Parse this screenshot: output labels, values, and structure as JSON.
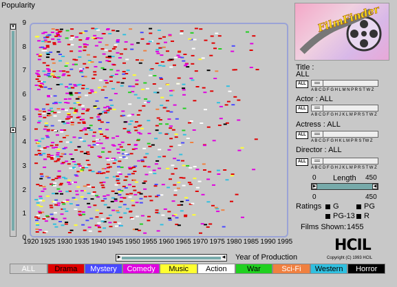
{
  "yaxis": {
    "label": "Popularity",
    "ticks": [
      "0",
      "1",
      "2",
      "3",
      "4",
      "5",
      "6",
      "7",
      "8",
      "9"
    ]
  },
  "xaxis": {
    "label": "Year of Production",
    "ticks": [
      "1920",
      "1925",
      "1930",
      "1935",
      "1940",
      "1945",
      "1950",
      "1955",
      "1960",
      "1965",
      "1970",
      "1975",
      "1980",
      "1985",
      "1990",
      "1995"
    ]
  },
  "logo": {
    "text": "FilmFinder"
  },
  "filters": {
    "title": {
      "label": "Title :",
      "value": "ALL",
      "letters": "A B C D F G H L M N P R S  T  W Z"
    },
    "actor": {
      "label": "Actor : ALL",
      "letters": "A B  C  D F G H  J K L M  P R  S  T W Z"
    },
    "actress": {
      "label": "Actress : ALL",
      "letters": "A B  C  D F G H K L  M  P R S  TW Z"
    },
    "director": {
      "label": "Director : ALL",
      "letters": "A B  C  D F G H  J K L  M  P R S  T W Z"
    },
    "all_button": "ALL"
  },
  "length": {
    "label": "Length",
    "min": "0",
    "max": "450",
    "low_value": "0",
    "high_value": "450"
  },
  "ratings": {
    "label": "Ratings",
    "items": [
      "G",
      "PG",
      "PG-13",
      "R"
    ]
  },
  "films_shown": {
    "label": "Films Shown:",
    "value": "1455"
  },
  "hcil": {
    "logo": "HCIL",
    "copyright": "Copyright (C) 1993 HCIL"
  },
  "genres": [
    {
      "label": "ALL",
      "color": "#c8c8c8",
      "text": "#ffffff"
    },
    {
      "label": "Drama",
      "color": "#e00000",
      "text": "#000000"
    },
    {
      "label": "Mystery",
      "color": "#4848ff",
      "text": "#ffffff"
    },
    {
      "label": "Comedy",
      "color": "#e000e0",
      "text": "#ffffff"
    },
    {
      "label": "Music",
      "color": "#ffff30",
      "text": "#000000"
    },
    {
      "label": "Action",
      "color": "#ffffff",
      "text": "#000000"
    },
    {
      "label": "War",
      "color": "#20d020",
      "text": "#000000"
    },
    {
      "label": "Sci-Fi",
      "color": "#f08040",
      "text": "#ffffff"
    },
    {
      "label": "Western",
      "color": "#30c0e0",
      "text": "#000000"
    },
    {
      "label": "Horror",
      "color": "#000000",
      "text": "#ffffff"
    }
  ]
}
